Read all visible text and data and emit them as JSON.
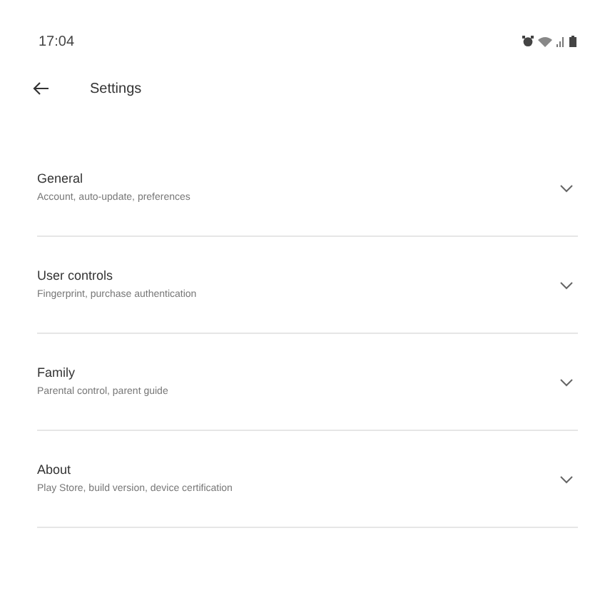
{
  "status_bar": {
    "time": "17:04"
  },
  "header": {
    "title": "Settings"
  },
  "sections": [
    {
      "title": "General",
      "subtitle": "Account, auto-update, preferences",
      "expanded": false
    },
    {
      "title": "User controls",
      "subtitle": "Fingerprint, purchase authentication",
      "expanded": false
    },
    {
      "title": "Family",
      "subtitle": "Parental control, parent guide",
      "expanded": false
    },
    {
      "title": "About",
      "subtitle": "Play Store, build version, device certification",
      "expanded": false
    }
  ]
}
